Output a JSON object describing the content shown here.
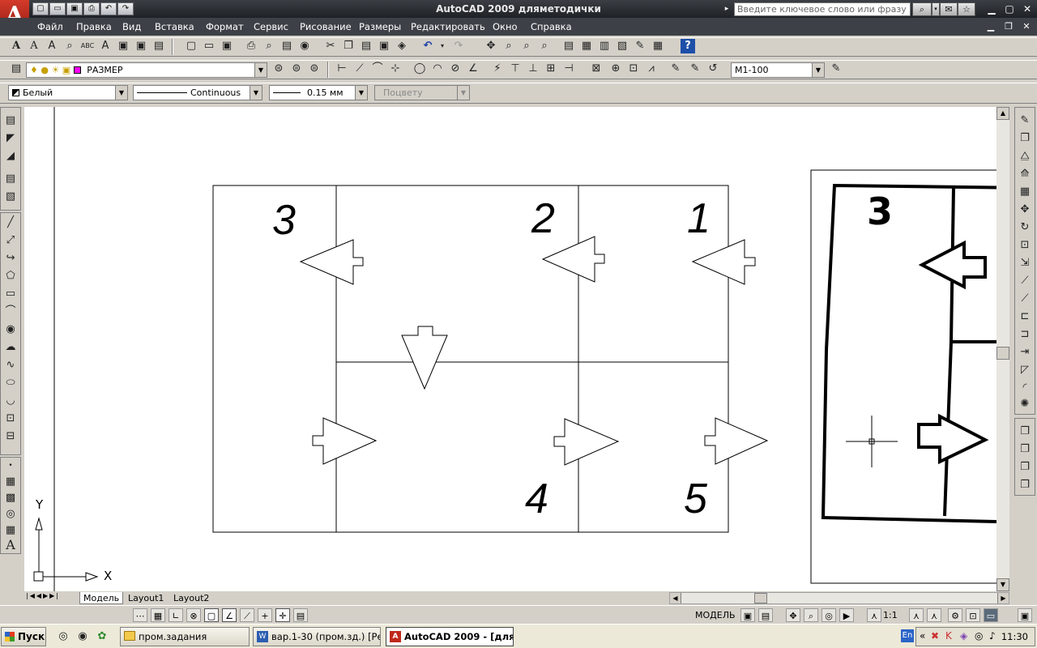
{
  "window": {
    "title": "AutoCAD 2009 дляметодички",
    "search_placeholder": "Введите ключевое слово или фразу",
    "app_logo": "A"
  },
  "menu": [
    "Файл",
    "Правка",
    "Вид",
    "Вставка",
    "Формат",
    "Сервис",
    "Рисование",
    "Размеры",
    "Редактировать",
    "Окно",
    "Справка"
  ],
  "layers": {
    "current_layer": "РАЗМЕР",
    "dim_style": "М1-100"
  },
  "properties": {
    "color": "Белый",
    "linetype": "Continuous",
    "lineweight": "0.15 мм",
    "plot_style": "Поцвету"
  },
  "drawing": {
    "cell_labels": [
      "3",
      "2",
      "1",
      "4",
      "5"
    ],
    "raster_label": "3",
    "ucs_y": "Y",
    "ucs_x": "X"
  },
  "tabs": [
    "Модель",
    "Layout1",
    "Layout2"
  ],
  "status": {
    "space": "МОДЕЛЬ",
    "scale": "1:1"
  },
  "taskbar": {
    "start": "Пуск",
    "items": [
      "пром.задания",
      "вар.1-30 (пром.зд.) [Ре...",
      "AutoCAD 2009 - [для..."
    ],
    "lang": "En",
    "clock": "11:30"
  },
  "colors": {
    "titlebar": "#2a2d32",
    "menubar": "#3d4147",
    "chrome": "#d4d0c8",
    "canvas": "#ffffff",
    "logo": "#c0291c"
  }
}
